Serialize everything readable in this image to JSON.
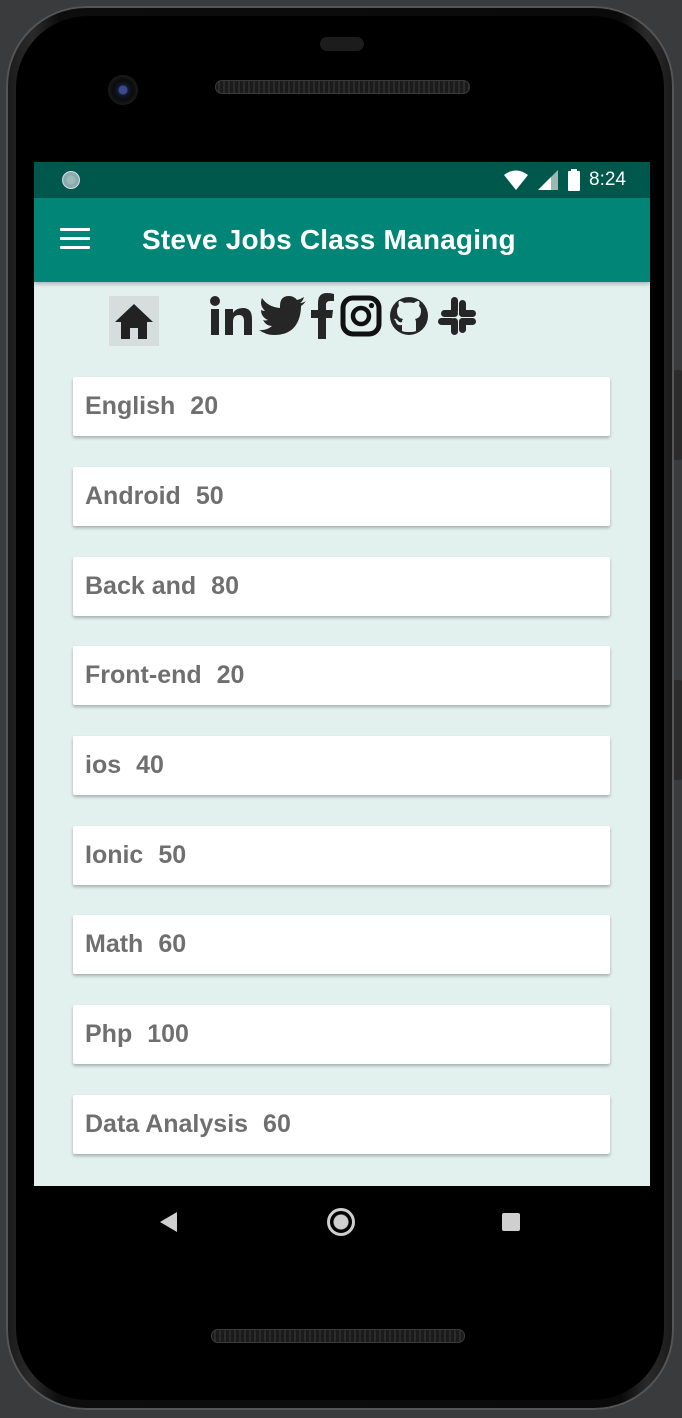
{
  "status_bar": {
    "time": "8:24"
  },
  "app_bar": {
    "title": "Steve Jobs Class Managing"
  },
  "icons": [
    "home-icon",
    "linkedin-icon",
    "twitter-icon",
    "facebook-icon",
    "instagram-icon",
    "github-icon",
    "slack-icon"
  ],
  "classes": [
    {
      "name": "English",
      "count": "20"
    },
    {
      "name": "Android",
      "count": "50"
    },
    {
      "name": "Back and",
      "count": "80"
    },
    {
      "name": "Front-end",
      "count": "20"
    },
    {
      "name": "ios",
      "count": "40"
    },
    {
      "name": "Ionic",
      "count": "50"
    },
    {
      "name": "Math",
      "count": "60"
    },
    {
      "name": "Php",
      "count": "100"
    },
    {
      "name": "Data Analysis",
      "count": "60"
    }
  ],
  "colors": {
    "status_bar": "#00574b",
    "app_bar": "#008577",
    "background": "#e2f1ee",
    "card_text": "#6f6f6f"
  }
}
